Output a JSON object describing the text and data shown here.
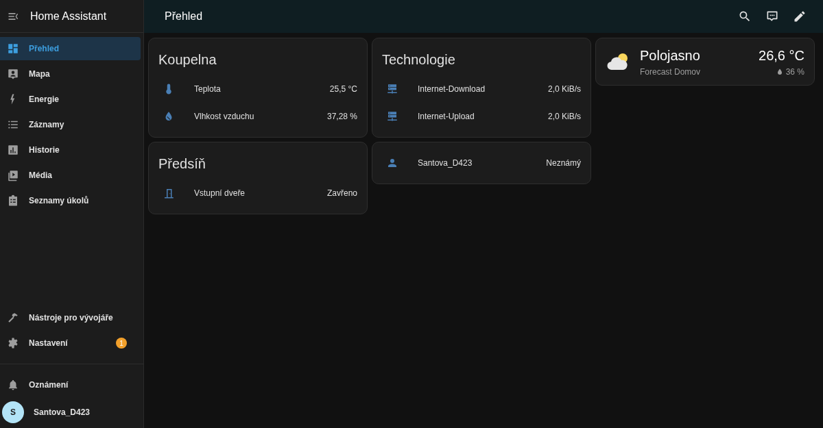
{
  "sidebar": {
    "title": "Home Assistant",
    "items": [
      {
        "label": "Přehled",
        "selected": true
      },
      {
        "label": "Mapa",
        "selected": false
      },
      {
        "label": "Energie",
        "selected": false
      },
      {
        "label": "Záznamy",
        "selected": false
      },
      {
        "label": "Historie",
        "selected": false
      },
      {
        "label": "Média",
        "selected": false
      },
      {
        "label": "Seznamy úkolů",
        "selected": false
      }
    ],
    "bottom_items": [
      {
        "label": "Nástroje pro vývojáře",
        "selected": false
      },
      {
        "label": "Nastavení",
        "selected": false,
        "badge": "1"
      }
    ],
    "notifications": {
      "label": "Oznámení"
    },
    "user": {
      "initial": "S",
      "name": "Santova_D423"
    }
  },
  "header": {
    "title": "Přehled"
  },
  "columns": [
    [
      {
        "title": "Koupelna",
        "rows": [
          {
            "name": "Teplota",
            "value": "25,5 °C"
          },
          {
            "name": "Vlhkost vzduchu",
            "value": "37,28 %"
          }
        ]
      },
      {
        "title": "Předsíň",
        "rows": [
          {
            "name": "Vstupní dveře",
            "value": "Zavřeno"
          }
        ]
      }
    ],
    [
      {
        "title": "Technologie",
        "rows": [
          {
            "name": "Internet-Download",
            "value": "2,0 KiB/s"
          },
          {
            "name": "Internet-Upload",
            "value": "2,0 KiB/s"
          }
        ]
      },
      {
        "rows": [
          {
            "name": "Santova_D423",
            "value": "Neznámý"
          }
        ]
      }
    ]
  ],
  "weather": {
    "condition": "Polojasno",
    "name": "Forecast Domov",
    "temperature": "26,6 °C",
    "humidity": "36 %"
  }
}
